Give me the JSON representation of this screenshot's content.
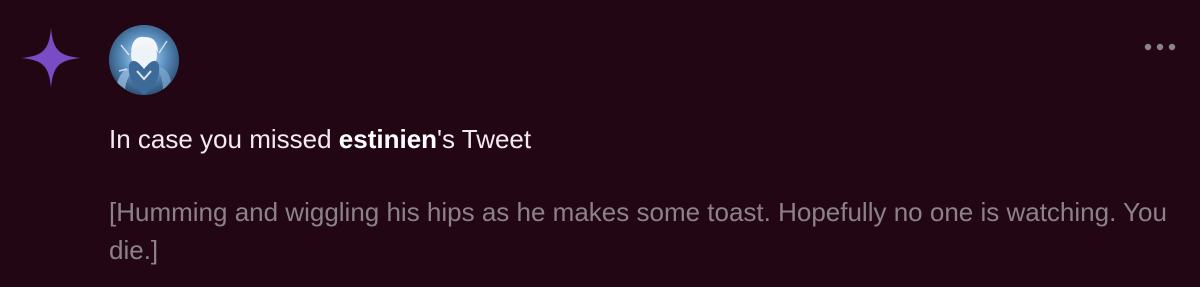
{
  "notification": {
    "icon": "sparkle-icon",
    "accent_color": "#794bc4",
    "avatar": "user-avatar",
    "more_icon": "more-dots-icon",
    "headline_prefix": "In case you missed ",
    "username": "estinien",
    "headline_suffix": "'s Tweet",
    "tweet_text": "[Humming and wiggling his hips as he makes some toast. Hopefully no one is watching. You die.]"
  },
  "colors": {
    "background": "#230614",
    "primary_text": "#f2eaee",
    "secondary_text": "#8b8288"
  }
}
